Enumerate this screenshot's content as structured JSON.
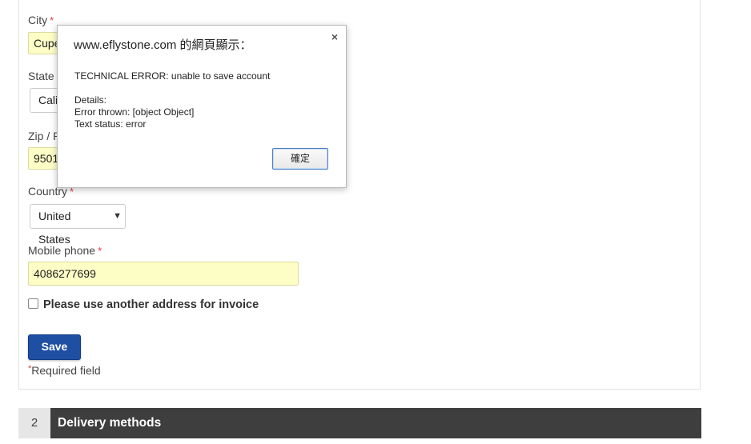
{
  "form": {
    "city_label": "City",
    "city_value": "Cupe",
    "state_label": "State",
    "state_value": "Cali",
    "zip_label": "Zip / P",
    "zip_value": "9501",
    "country_label": "Country",
    "country_value": "United States",
    "mobile_label": "Mobile phone",
    "mobile_value": "4086277699",
    "required_star": "*",
    "invoice_checkbox_label": "Please use another address for invoice",
    "save_label": "Save",
    "required_note": "Required field"
  },
  "section": {
    "number": "2",
    "title": "Delivery methods"
  },
  "dialog": {
    "title": "www.eflystone.com 的網頁顯示：",
    "close": "×",
    "line1": "TECHNICAL ERROR: unable to save account",
    "line2": "Details:",
    "line3": "Error thrown: [object Object]",
    "line4": "Text status: error",
    "ok_label": "確定"
  },
  "colors": {
    "accent": "#1f4fa3",
    "required": "#e03a3a",
    "input_autofill": "#fdfdc6",
    "section_bar": "#3e3e3e"
  }
}
